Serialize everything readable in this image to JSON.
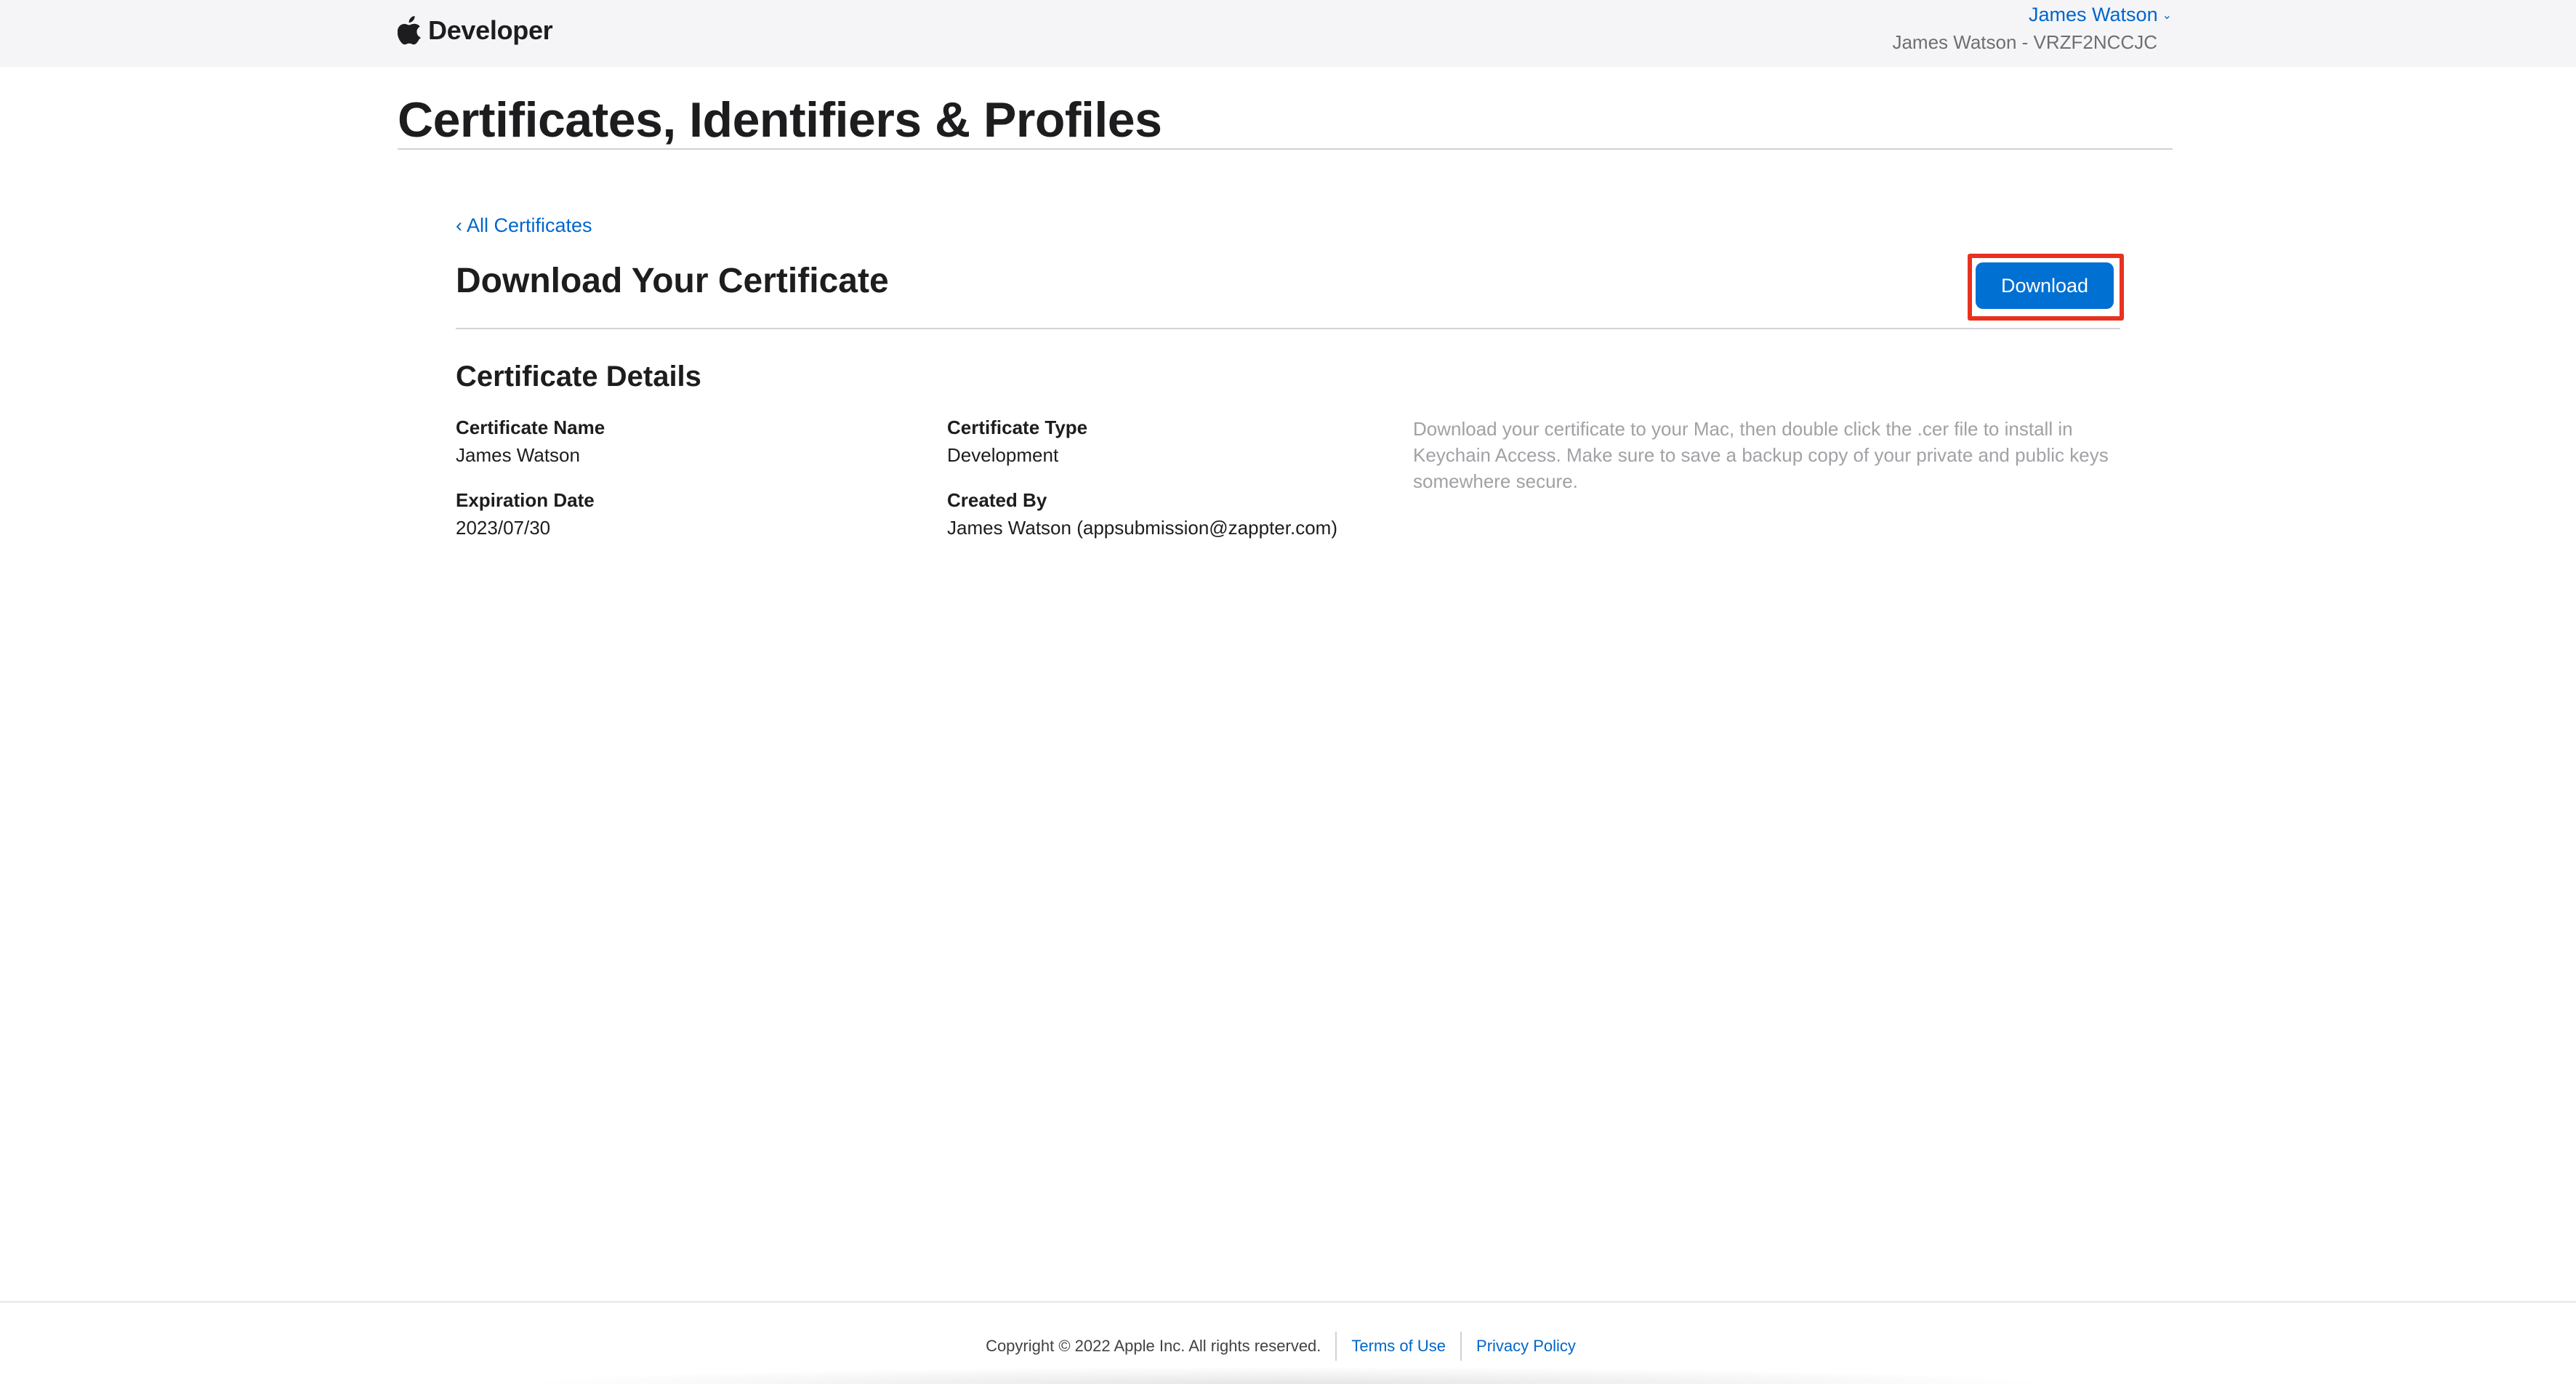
{
  "header": {
    "brand": "Developer",
    "account_name": "James Watson",
    "team_line": "James Watson - VRZF2NCCJC"
  },
  "page": {
    "title": "Certificates, Identifiers & Profiles"
  },
  "content": {
    "back_link": "‹ All Certificates",
    "section_title": "Download Your Certificate",
    "download_label": "Download",
    "details_title": "Certificate Details",
    "fields": {
      "certificate_name": {
        "label": "Certificate Name",
        "value": "James Watson"
      },
      "expiration_date": {
        "label": "Expiration Date",
        "value": "2023/07/30"
      },
      "certificate_type": {
        "label": "Certificate Type",
        "value": "Development"
      },
      "created_by": {
        "label": "Created By",
        "value": "James Watson (appsubmission@zappter.com)"
      }
    },
    "hint": "Download your certificate to your Mac, then double click the .cer file to install in Keychain Access. Make sure to save a backup copy of your private and public keys somewhere secure."
  },
  "footer": {
    "copyright": "Copyright © 2022 Apple Inc. All rights reserved.",
    "terms": "Terms of Use",
    "privacy": "Privacy Policy"
  },
  "colors": {
    "link": "#0066cc",
    "button": "#0070d2",
    "highlight": "#e8321f"
  },
  "icons": {
    "brand": "apple-logo-icon",
    "account_menu": "chevron-down-icon"
  }
}
